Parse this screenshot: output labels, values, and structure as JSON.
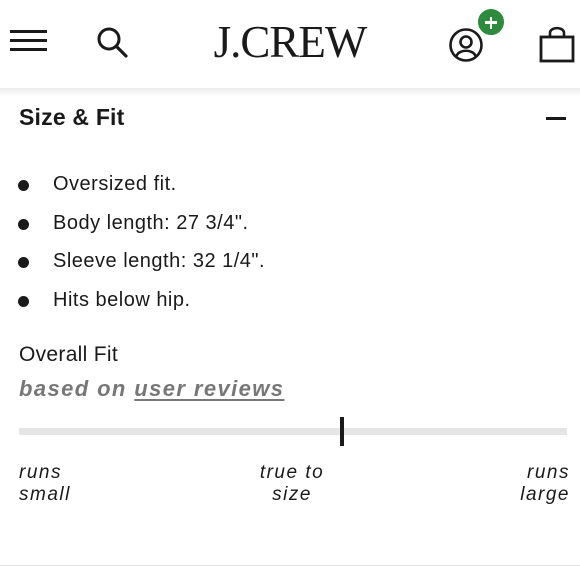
{
  "header": {
    "logo": "J.CREW",
    "icons": [
      "hamburger-menu-icon",
      "search-icon",
      "account-icon",
      "add-icon",
      "shopping-bag-icon"
    ],
    "badge_color": "#2e8b3e"
  },
  "section": {
    "title": "Size & Fit",
    "bullets": [
      "Oversized fit.",
      "Body length: 27 3/4\".",
      "Sleeve length: 32 1/4\".",
      "Hits below hip."
    ]
  },
  "fit": {
    "title": "Overall Fit",
    "subtitle_prefix": "based on",
    "subtitle_link": "user reviews",
    "indicator_position": 0.59,
    "scale": {
      "left": [
        "runs",
        "small"
      ],
      "middle": [
        "true to",
        "size"
      ],
      "right": [
        "runs",
        "large"
      ]
    }
  }
}
